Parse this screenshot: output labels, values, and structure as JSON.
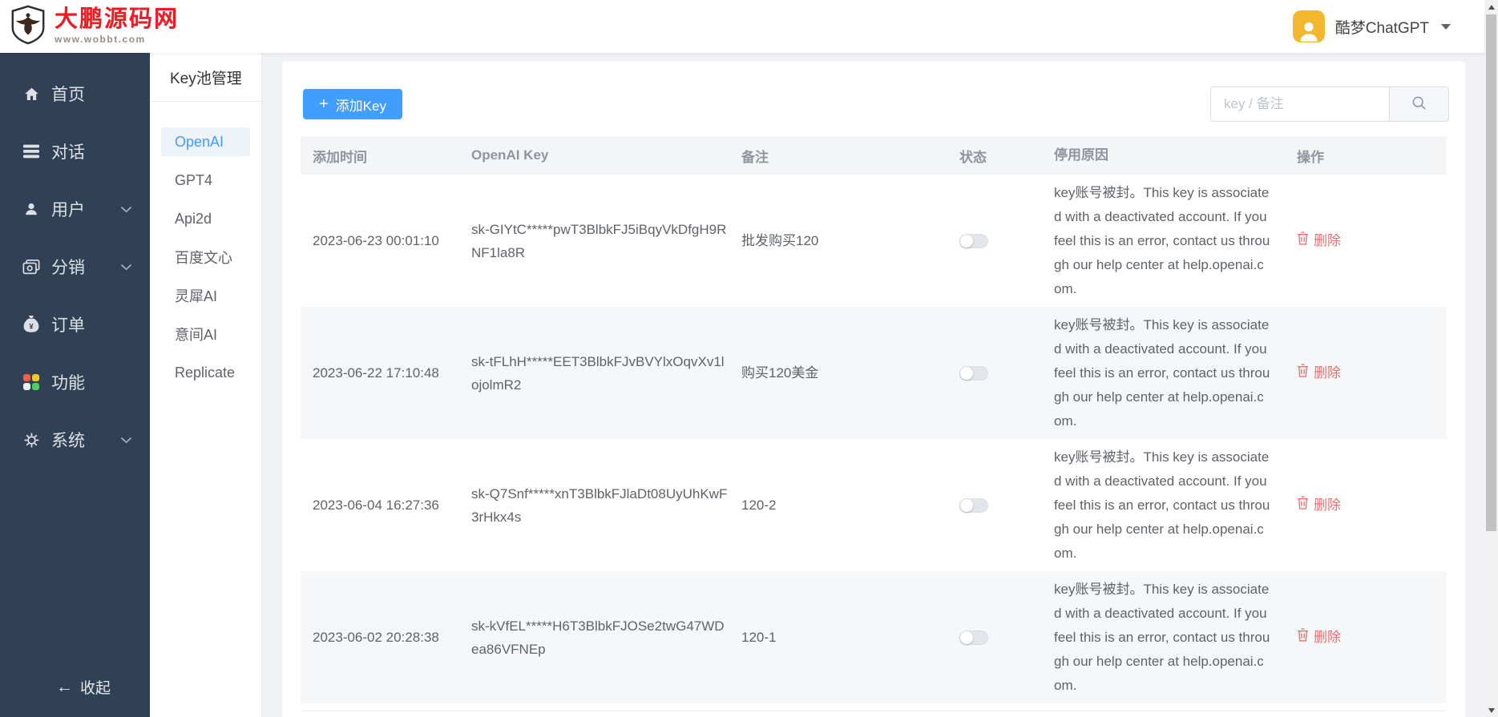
{
  "topbar": {
    "logo_title": "大鹏源码网",
    "logo_subtitle": "www.wobbt.com",
    "username": "酷梦ChatGPT"
  },
  "sidebar": {
    "items": [
      {
        "label": "首页",
        "icon": "home-icon",
        "has_arrow": false
      },
      {
        "label": "对话",
        "icon": "chat-icon",
        "has_arrow": false
      },
      {
        "label": "用户",
        "icon": "user-icon",
        "has_arrow": true
      },
      {
        "label": "分销",
        "icon": "distribution-icon",
        "has_arrow": true
      },
      {
        "label": "订单",
        "icon": "order-icon",
        "has_arrow": false
      },
      {
        "label": "功能",
        "icon": "features-icon",
        "has_arrow": false
      },
      {
        "label": "系统",
        "icon": "system-icon",
        "has_arrow": true
      }
    ],
    "collapse_label": "收起"
  },
  "submenu": {
    "title": "Key池管理",
    "items": [
      {
        "label": "OpenAI",
        "active": true
      },
      {
        "label": "GPT4",
        "active": false
      },
      {
        "label": "Api2d",
        "active": false
      },
      {
        "label": "百度文心",
        "active": false
      },
      {
        "label": "灵犀AI",
        "active": false
      },
      {
        "label": "意间AI",
        "active": false
      },
      {
        "label": "Replicate",
        "active": false
      }
    ]
  },
  "toolbar": {
    "add_button": "添加Key",
    "search_placeholder": "key / 备注"
  },
  "table": {
    "columns": [
      "添加时间",
      "OpenAI Key",
      "备注",
      "状态",
      "停用原因",
      "操作"
    ],
    "delete_label": "删除",
    "rows": [
      {
        "time": "2023-06-23 00:01:10",
        "key": "sk-GIYtC*****pwT3BlbkFJ5iBqyVkDfgH9RNF1la8R",
        "note": "批发购买120",
        "enabled": false,
        "reason": "key账号被封。This key is associated with a deactivated account. If you feel this is an error, contact us through our help center at help.openai.com."
      },
      {
        "time": "2023-06-22 17:10:48",
        "key": "sk-tFLhH*****EET3BlbkFJvBVYlxOqvXv1lojolmR2",
        "note": "购买120美金",
        "enabled": false,
        "reason": "key账号被封。This key is associated with a deactivated account. If you feel this is an error, contact us through our help center at help.openai.com."
      },
      {
        "time": "2023-06-04 16:27:36",
        "key": "sk-Q7Snf*****xnT3BlbkFJlaDt08UyUhKwF3rHkx4s",
        "note": "120-2",
        "enabled": false,
        "reason": "key账号被封。This key is associated with a deactivated account. If you feel this is an error, contact us through our help center at help.openai.com."
      },
      {
        "time": "2023-06-02 20:28:38",
        "key": "sk-kVfEL*****H6T3BlbkFJOSe2twG47WDea86VFNEp",
        "note": "120-1",
        "enabled": false,
        "reason": "key账号被封。This key is associated with a deactivated account. If you feel this is an error, contact us through our help center at help.openai.com."
      }
    ]
  },
  "colors": {
    "brand_red": "#ed1c24",
    "primary_blue": "#409eff",
    "danger_red": "#f56c6c",
    "avatar_yellow": "#f3b62f",
    "sidebar_dark": "#304156",
    "main_background": "#f0f2f5"
  }
}
